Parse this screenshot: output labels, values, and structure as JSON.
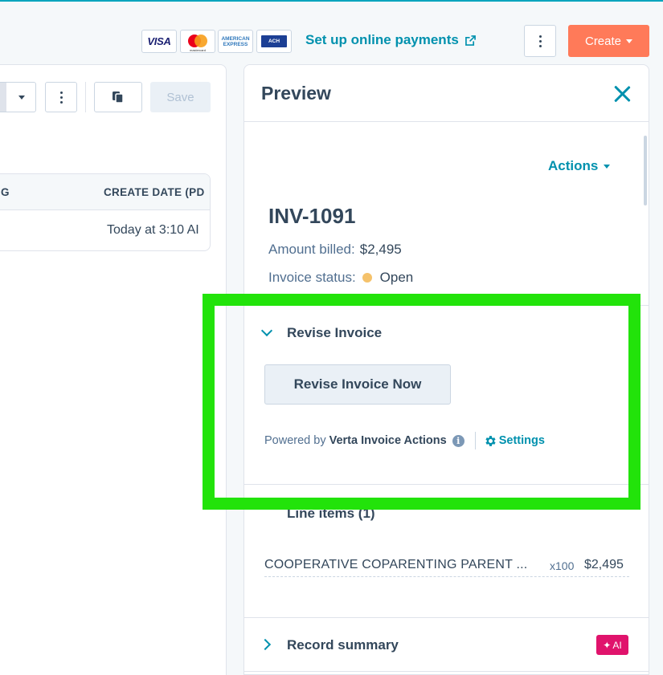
{
  "topbar": {
    "payment_logos": {
      "visa": "VISA",
      "mastercard": "mastercard",
      "amex": "AMERICAN EXPRESS",
      "ach": "ACH"
    },
    "setup_payments_label": "Set up online payments",
    "create_label": "Create"
  },
  "toolbar": {
    "save_label": "Save"
  },
  "table": {
    "headers": [
      "G",
      "CREATE DATE (PD"
    ],
    "rows": [
      {
        "create_date": "Today at 3:10 AI"
      }
    ]
  },
  "preview": {
    "title": "Preview",
    "actions_label": "Actions",
    "invoice_number": "INV-1091",
    "amount_billed_label": "Amount billed:",
    "amount_billed_value": "$2,495",
    "status_label": "Invoice status:",
    "status_value": "Open",
    "status_color": "#f5c26b",
    "revise_section": {
      "title": "Revise Invoice",
      "button_label": "Revise Invoice Now",
      "powered_by_label": "Powered by",
      "app_name": "Verta Invoice Actions",
      "settings_label": "Settings"
    },
    "line_items": {
      "title": "Line items (1)",
      "items": [
        {
          "name": "COOPERATIVE COPARENTING PARENT ...",
          "qty": "x100",
          "price": "$2,495"
        }
      ]
    },
    "record_summary": {
      "title": "Record summary",
      "badge": "AI"
    }
  },
  "colors": {
    "accent": "#0091ae",
    "create_button": "#ff7a59",
    "highlight": "#22e30a",
    "ai_badge": "#e0136c"
  }
}
